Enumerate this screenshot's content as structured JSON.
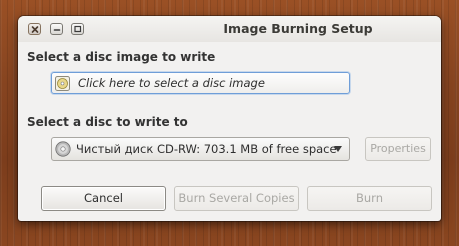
{
  "window": {
    "title": "Image Burning Setup",
    "controls": {
      "close_icon": "close-icon",
      "minimize_icon": "minimize-icon",
      "maximize_icon": "maximize-icon"
    }
  },
  "image_section": {
    "label": "Select a disc image to write",
    "chooser": {
      "icon": "disc-image-icon",
      "text": "Click here to select a disc image"
    }
  },
  "disc_section": {
    "label": "Select a disc to write to",
    "selected": {
      "icon": "optical-disc-icon",
      "text": "Чистый диск CD-RW: 703.1 MB of free space"
    },
    "properties_label": "Properties"
  },
  "actions": {
    "cancel_label": "Cancel",
    "copies_label": "Burn Several Copies",
    "burn_label": "Burn"
  },
  "colors": {
    "window_bg": "#f2f1f0",
    "focus_border": "#6f9ed8",
    "disabled_text": "#a9a8a4",
    "desktop_wood": "#864420"
  }
}
